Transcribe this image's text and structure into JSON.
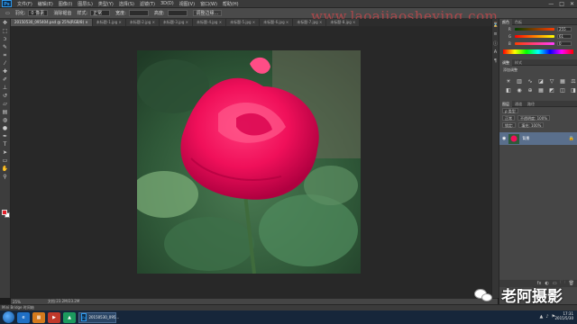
{
  "app": {
    "logo": "Ps"
  },
  "menu": [
    "文件(F)",
    "编辑(E)",
    "图像(I)",
    "图层(L)",
    "类型(Y)",
    "选择(S)",
    "滤镜(T)",
    "3D(D)",
    "视图(V)",
    "窗口(W)",
    "帮助(H)"
  ],
  "window_controls": [
    "—",
    "□",
    "✕"
  ],
  "options": {
    "mode_label": "羽化:",
    "feather_value": "0 像素",
    "antialias": "消除锯齿",
    "style_label": "样式:",
    "style_value": "正常",
    "width_label": "宽度:",
    "height_label": "高度:",
    "refine_button": "调整边缘..."
  },
  "watermark_top": "www.laoajiaosheying.com",
  "doc_tabs": [
    {
      "label": "20150530_095404.psd @ 25%(RGB/8) ×",
      "active": true
    },
    {
      "label": "未标题-1.jpg ×",
      "active": false
    },
    {
      "label": "未标题-2.jpg ×",
      "active": false
    },
    {
      "label": "未标题-3.jpg ×",
      "active": false
    },
    {
      "label": "未标题-4.jpg ×",
      "active": false
    },
    {
      "label": "未标题-5.jpg ×",
      "active": false
    },
    {
      "label": "未标题-6.jpg ×",
      "active": false
    },
    {
      "label": "未标题-7.jpg ×",
      "active": false
    },
    {
      "label": "未标题-8.jpg ×",
      "active": false
    }
  ],
  "tools": [
    "move",
    "marquee",
    "lasso",
    "quick-select",
    "crop",
    "eyedropper",
    "healing",
    "brush",
    "stamp",
    "history-brush",
    "eraser",
    "gradient",
    "blur",
    "dodge",
    "pen",
    "type",
    "path-select",
    "shape",
    "hand",
    "zoom"
  ],
  "status": {
    "zoom": "25%",
    "doc": "文档:23.2M/23.2M"
  },
  "timeline": "Mini Bridge  时间轴",
  "color_panel": {
    "tabs": [
      "颜色",
      "色板"
    ],
    "channels": [
      {
        "label": "R",
        "value": "255"
      },
      {
        "label": "G",
        "value": "61"
      },
      {
        "label": "B",
        "value": "0"
      }
    ]
  },
  "adjust_panel": {
    "tabs": [
      "调整",
      "样式"
    ],
    "title": "添加调整"
  },
  "layers_panel": {
    "tabs": [
      "图层",
      "通道",
      "路径"
    ],
    "kind": "ρ 类型",
    "blend": "正常",
    "opacity": "不透明度: 100%",
    "lock": "锁定:",
    "fill": "填充: 100%",
    "layer_name": "背景",
    "bottom_icons": [
      "fx",
      "◐",
      "▭",
      "🗀",
      "🗑"
    ]
  },
  "taskbar": {
    "apps": [
      {
        "label": "e",
        "color": "#1f6fc4"
      },
      {
        "label": "▦",
        "color": "#d47a1d"
      },
      {
        "label": "▶",
        "color": "#c0392b"
      },
      {
        "label": "▲",
        "color": "#1c9a5e"
      }
    ],
    "ps_label": "20150530_095..."
  },
  "clock": {
    "time": "17:31",
    "date": "2015/5/30"
  },
  "wechat": {
    "name": "老阿摄影"
  }
}
